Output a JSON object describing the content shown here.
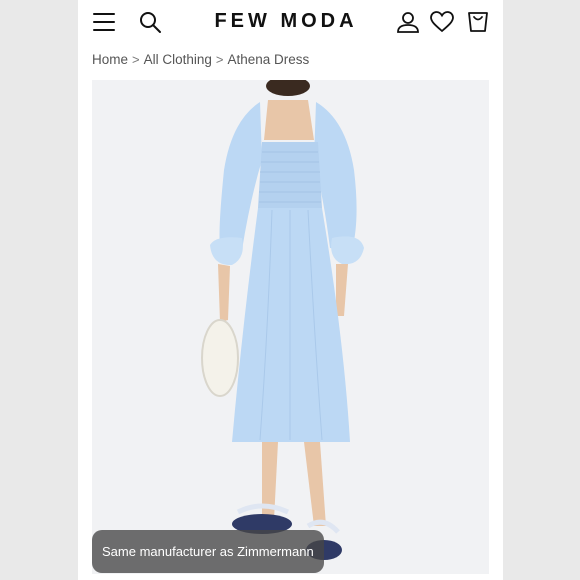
{
  "header": {
    "brand": "FEW MODA",
    "icons": [
      "menu-icon",
      "search-icon",
      "account-icon",
      "heart-icon",
      "cart-icon"
    ]
  },
  "breadcrumb": {
    "items": [
      "Home",
      "All Clothing",
      "Athena Dress"
    ],
    "separator": ">"
  },
  "product": {
    "image_label": "Athena Dress",
    "dress_color": "#bcd8f4"
  },
  "caption": {
    "text": "Same manufacturer as Zimmermann"
  },
  "colors": {
    "page_bg": "#ffffff",
    "outer_bg": "#e9e9e9",
    "photo_bg": "#f1f2f4"
  }
}
